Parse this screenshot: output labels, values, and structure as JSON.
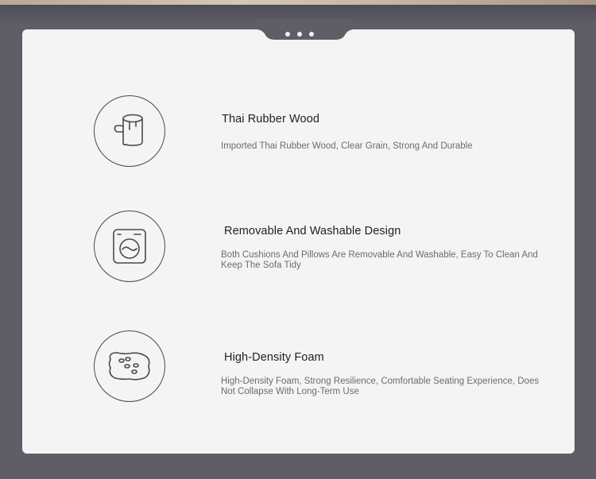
{
  "colors": {
    "background": "#5f5e66",
    "card": "#f4f4f4",
    "icon_stroke": "#4a4a4a",
    "title": "#1f1f1f",
    "description": "#6c6c6c"
  },
  "features": [
    {
      "icon": "log-icon",
      "title": "Thai Rubber Wood",
      "description": "Imported Thai Rubber Wood, Clear Grain, Strong And Durable"
    },
    {
      "icon": "washing-machine-icon",
      "title": "Removable And Washable Design",
      "description": "Both Cushions And Pillows Are Removable And Washable, Easy To Clean And Keep The Sofa Tidy"
    },
    {
      "icon": "foam-sponge-icon",
      "title": "High-Density Foam",
      "description": "High-Density Foam, Strong Resilience, Comfortable Seating Experience, Does Not Collapse With Long-Term Use"
    }
  ]
}
